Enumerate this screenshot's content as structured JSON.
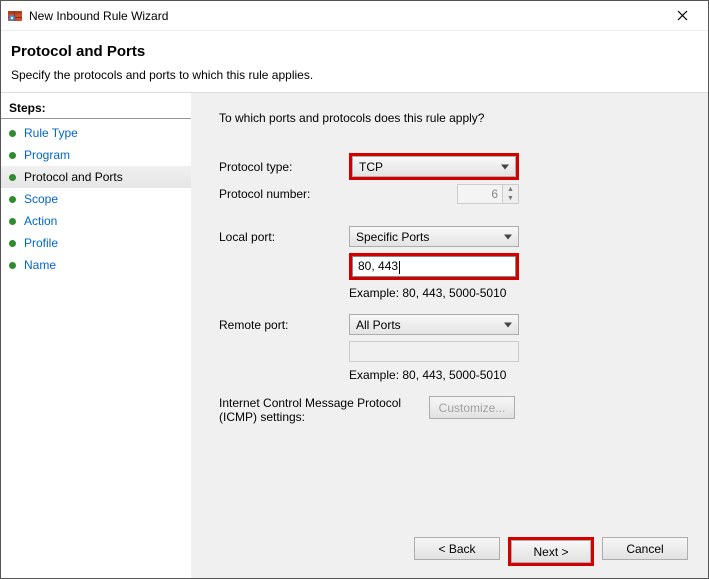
{
  "window": {
    "title": "New Inbound Rule Wizard"
  },
  "header": {
    "title": "Protocol and Ports",
    "description": "Specify the protocols and ports to which this rule applies."
  },
  "steps": {
    "title": "Steps:",
    "items": [
      {
        "label": "Rule Type",
        "current": false
      },
      {
        "label": "Program",
        "current": false
      },
      {
        "label": "Protocol and Ports",
        "current": true
      },
      {
        "label": "Scope",
        "current": false
      },
      {
        "label": "Action",
        "current": false
      },
      {
        "label": "Profile",
        "current": false
      },
      {
        "label": "Name",
        "current": false
      }
    ]
  },
  "main": {
    "question": "To which ports and protocols does this rule apply?",
    "protocol_type_label": "Protocol type:",
    "protocol_type_value": "TCP",
    "protocol_number_label": "Protocol number:",
    "protocol_number_value": "6",
    "local_port_label": "Local port:",
    "local_port_mode": "Specific Ports",
    "local_port_value": "80, 443",
    "local_port_example": "Example: 80, 443, 5000-5010",
    "remote_port_label": "Remote port:",
    "remote_port_mode": "All Ports",
    "remote_port_value": "",
    "remote_port_example": "Example: 80, 443, 5000-5010",
    "icmp_label": "Internet Control Message Protocol (ICMP) settings:",
    "customize_btn": "Customize..."
  },
  "buttons": {
    "back": "< Back",
    "next": "Next >",
    "cancel": "Cancel"
  }
}
